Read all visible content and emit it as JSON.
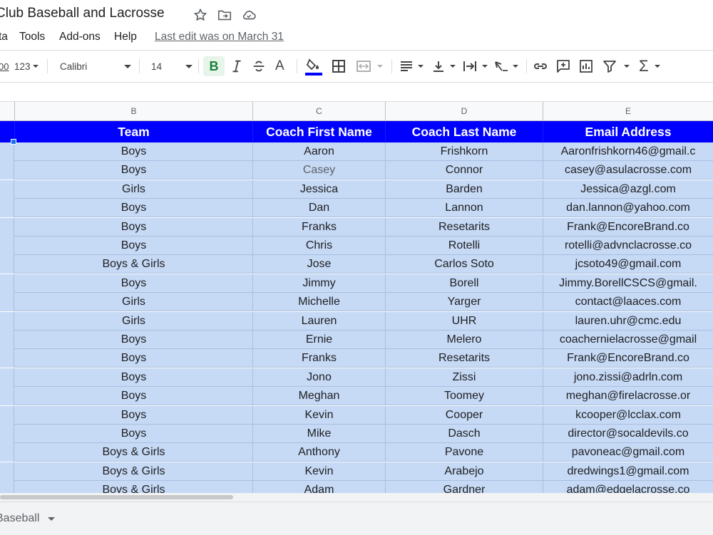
{
  "document": {
    "title": "Club Baseball and Lacrosse",
    "last_edit": "Last edit was on March 31"
  },
  "menu": [
    "ta",
    "Tools",
    "Add-ons",
    "Help"
  ],
  "toolbar": {
    "number_format": "123",
    "font": "Calibri",
    "font_size": "14",
    "bold": "B",
    "text_color": "A",
    "text_color_hex": "#0000ff",
    "icons": [
      "decimal-icon",
      "bold-icon",
      "italic-icon",
      "strikethrough-icon",
      "text-color-icon",
      "fill-color-icon",
      "borders-icon",
      "merge-cells-icon",
      "horizontal-align-icon",
      "vertical-align-icon",
      "text-wrap-icon",
      "text-rotation-icon",
      "link-icon",
      "comment-icon",
      "chart-icon",
      "filter-icon",
      "functions-icon"
    ]
  },
  "columns": {
    "letters": [
      "B",
      "C",
      "D",
      "E"
    ],
    "headers": [
      "Team",
      "Coach First Name",
      "Coach Last Name",
      "Email Address"
    ]
  },
  "rows": [
    [
      "Boys",
      "Aaron",
      "Frishkorn",
      "Aaronfrishkorn46@gmail.c"
    ],
    [
      "Boys",
      "Casey",
      "Connor",
      "casey@asulacrosse.com"
    ],
    [
      "Girls",
      "Jessica",
      "Barden",
      "Jessica@azgl.com"
    ],
    [
      "Boys",
      "Dan",
      "Lannon",
      "dan.lannon@yahoo.com"
    ],
    [
      "Boys",
      "Franks",
      "Resetarits",
      "Frank@EncoreBrand.co"
    ],
    [
      "Boys",
      "Chris",
      "Rotelli",
      "rotelli@advnclacrosse.co"
    ],
    [
      "Boys & Girls",
      "Jose",
      "Carlos Soto",
      "jcsoto49@gmail.com"
    ],
    [
      "Boys",
      "Jimmy",
      "Borell",
      "Jimmy.BorellCSCS@gmail."
    ],
    [
      "Girls",
      "Michelle",
      "Yarger",
      "contact@laaces.com"
    ],
    [
      "Girls",
      "Lauren",
      "UHR",
      "lauren.uhr@cmc.edu"
    ],
    [
      "Boys",
      "Ernie",
      "Melero",
      "coachernielacrosse@gmail"
    ],
    [
      "Boys",
      "Franks",
      "Resetarits",
      "Frank@EncoreBrand.co"
    ],
    [
      "Boys",
      "Jono",
      "Zissi",
      "jono.zissi@adrln.com"
    ],
    [
      "Boys",
      "Meghan",
      "Toomey",
      "meghan@firelacrosse.or"
    ],
    [
      "Boys",
      "Kevin",
      "Cooper",
      "kcooper@lcclax.com"
    ],
    [
      "Boys",
      "Mike",
      "Dasch",
      "director@socaldevils.co"
    ],
    [
      "Boys & Girls",
      "Anthony",
      "Pavone",
      "pavoneac@gmail.com"
    ],
    [
      "Boys &  Girls",
      "Kevin",
      "Arabejo",
      "dredwings1@gmail.com"
    ],
    [
      "Boys & Girls",
      "Adam",
      "Gardner",
      "adam@edgelacrosse.co"
    ]
  ],
  "sheet_tab": "Baseball"
}
